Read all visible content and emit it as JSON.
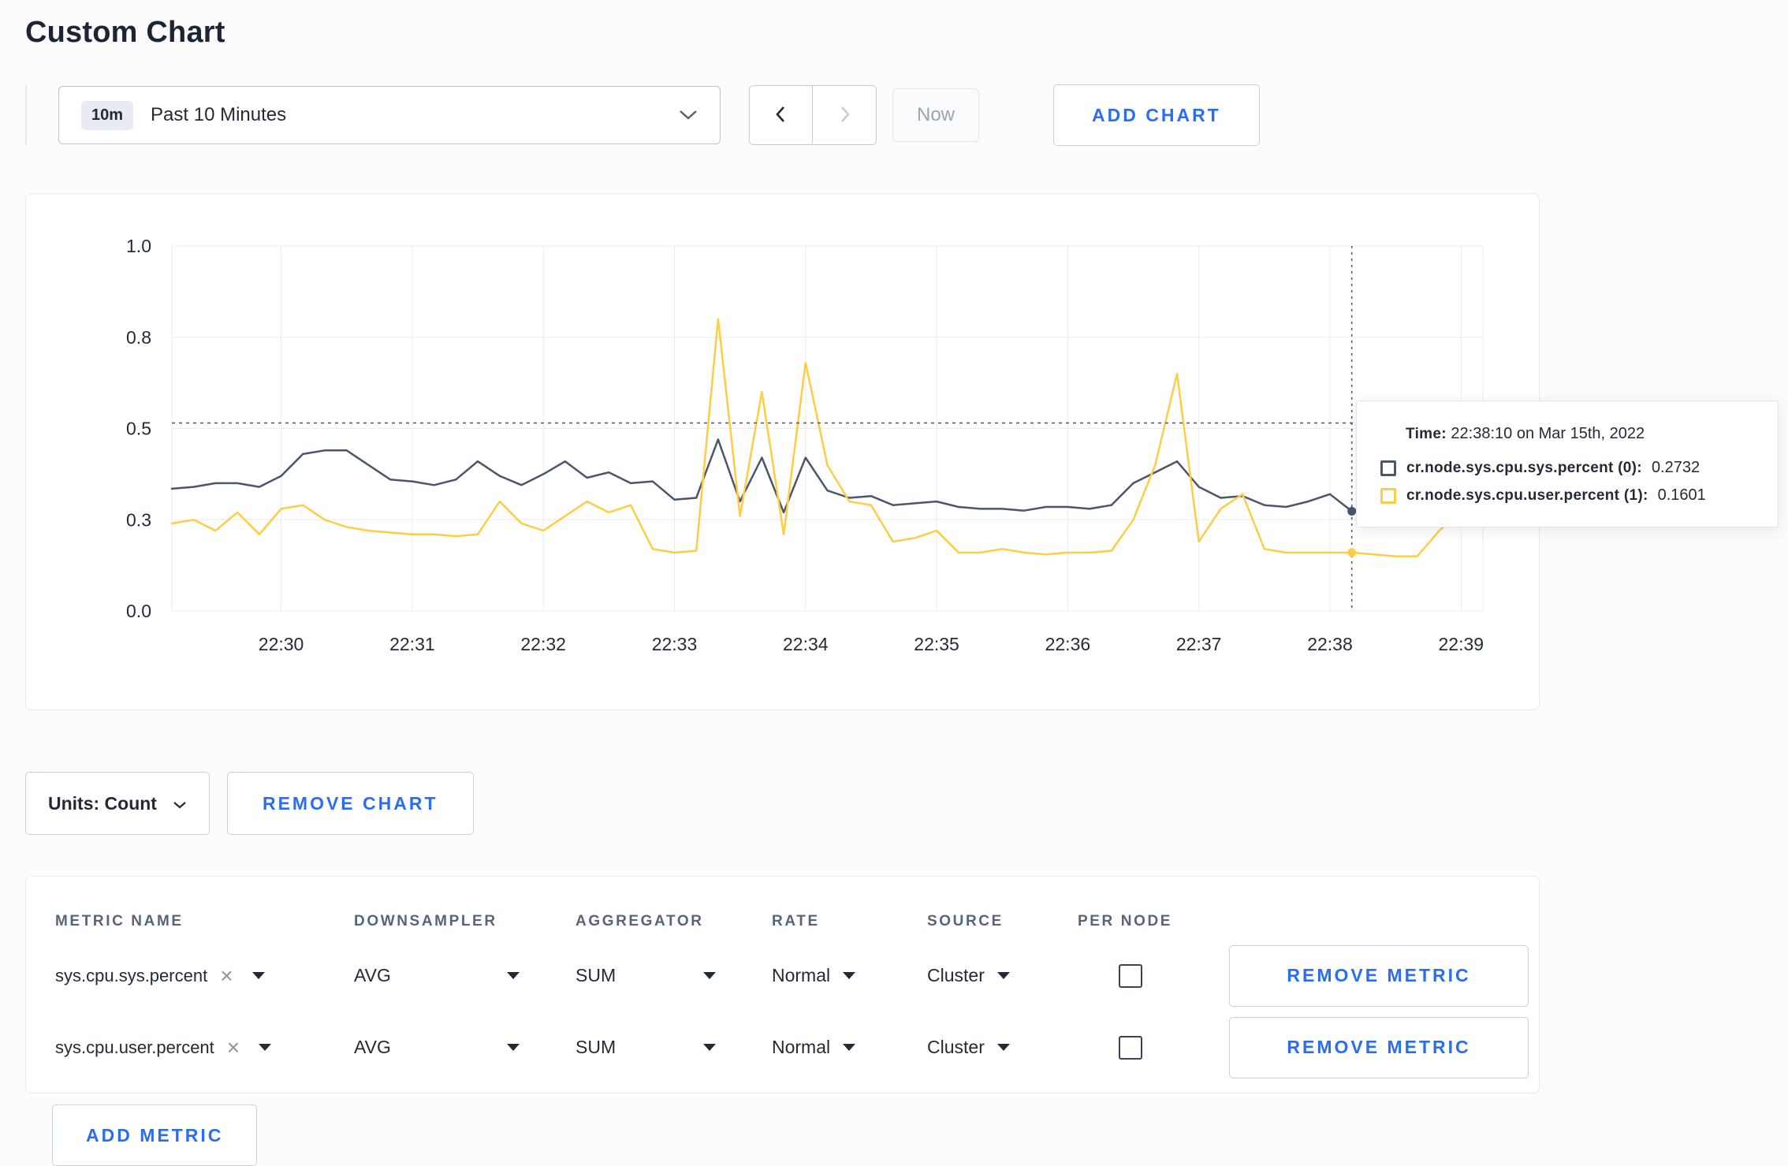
{
  "colors": {
    "accent": "#2a6df4",
    "series_sys": "#4a566b",
    "series_user": "#ffcd44",
    "crosshair": "#4a566b",
    "grid": "#e9ecf1"
  },
  "page": {
    "title": "Custom Chart"
  },
  "toolbar": {
    "range_badge": "10m",
    "range_label": "Past 10 Minutes",
    "now_label": "Now",
    "add_chart_label": "ADD CHART"
  },
  "tooltip": {
    "time_label": "Time:",
    "time_value": "22:38:10 on Mar 15th, 2022",
    "series": [
      {
        "label": "cr.node.sys.cpu.sys.percent (0):",
        "value": "0.2732"
      },
      {
        "label": "cr.node.sys.cpu.user.percent (1):",
        "value": "0.1601"
      }
    ]
  },
  "chart_data": {
    "type": "line",
    "title": "",
    "xlabel": "",
    "ylabel": "",
    "ylim": [
      0,
      1
    ],
    "grid": true,
    "x_start_time": "22:29:10",
    "x_step_seconds": 10,
    "x_tick_first_offset_sec": 50,
    "x_tick_interval_sec": 60,
    "x_tick_labels": [
      "22:30",
      "22:31",
      "22:32",
      "22:33",
      "22:34",
      "22:35",
      "22:36",
      "22:37",
      "22:38",
      "22:39"
    ],
    "y_ticks": [
      {
        "value": 0,
        "label": "0.0"
      },
      {
        "value": 0.25,
        "label": "0.3"
      },
      {
        "value": 0.5,
        "label": "0.5"
      },
      {
        "value": 0.75,
        "label": "0.8"
      },
      {
        "value": 1,
        "label": "1.0"
      }
    ],
    "crosshair": {
      "index": 54,
      "time": "22:38:10",
      "h_value": 0.515
    },
    "series": [
      {
        "name": "cr.node.sys.cpu.sys.percent",
        "color": "#4a566b",
        "values": [
          0.335,
          0.34,
          0.35,
          0.35,
          0.34,
          0.37,
          0.43,
          0.44,
          0.44,
          0.4,
          0.36,
          0.355,
          0.345,
          0.36,
          0.41,
          0.37,
          0.345,
          0.375,
          0.41,
          0.365,
          0.38,
          0.35,
          0.355,
          0.305,
          0.31,
          0.47,
          0.3,
          0.42,
          0.27,
          0.42,
          0.33,
          0.31,
          0.315,
          0.29,
          0.295,
          0.3,
          0.285,
          0.28,
          0.28,
          0.275,
          0.285,
          0.285,
          0.28,
          0.29,
          0.35,
          0.38,
          0.41,
          0.34,
          0.31,
          0.315,
          0.29,
          0.285,
          0.3,
          0.32,
          0.2732,
          0.295,
          0.305,
          0.31,
          0.27,
          0.3,
          0.305
        ]
      },
      {
        "name": "cr.node.sys.cpu.user.percent",
        "color": "#ffcd44",
        "values": [
          0.24,
          0.25,
          0.22,
          0.27,
          0.21,
          0.28,
          0.29,
          0.25,
          0.23,
          0.22,
          0.215,
          0.21,
          0.21,
          0.205,
          0.21,
          0.3,
          0.24,
          0.22,
          0.26,
          0.3,
          0.27,
          0.29,
          0.17,
          0.16,
          0.165,
          0.8,
          0.26,
          0.6,
          0.21,
          0.68,
          0.4,
          0.3,
          0.29,
          0.19,
          0.2,
          0.22,
          0.16,
          0.16,
          0.17,
          0.16,
          0.155,
          0.16,
          0.16,
          0.165,
          0.25,
          0.4,
          0.65,
          0.19,
          0.28,
          0.32,
          0.17,
          0.16,
          0.16,
          0.16,
          0.1601,
          0.155,
          0.15,
          0.15,
          0.22,
          0.27,
          0.24
        ]
      }
    ]
  },
  "controls": {
    "units_label": "Units: Count",
    "remove_chart_label": "REMOVE CHART",
    "add_metric_label": "ADD METRIC"
  },
  "table": {
    "headers": [
      "METRIC NAME",
      "DOWNSAMPLER",
      "AGGREGATOR",
      "RATE",
      "SOURCE",
      "PER NODE"
    ],
    "rows": [
      {
        "metric": "sys.cpu.sys.percent",
        "downsampler": "AVG",
        "aggregator": "SUM",
        "rate": "Normal",
        "source": "Cluster",
        "per_node_checked": false,
        "remove_label": "REMOVE METRIC"
      },
      {
        "metric": "sys.cpu.user.percent",
        "downsampler": "AVG",
        "aggregator": "SUM",
        "rate": "Normal",
        "source": "Cluster",
        "per_node_checked": false,
        "remove_label": "REMOVE METRIC"
      }
    ]
  }
}
